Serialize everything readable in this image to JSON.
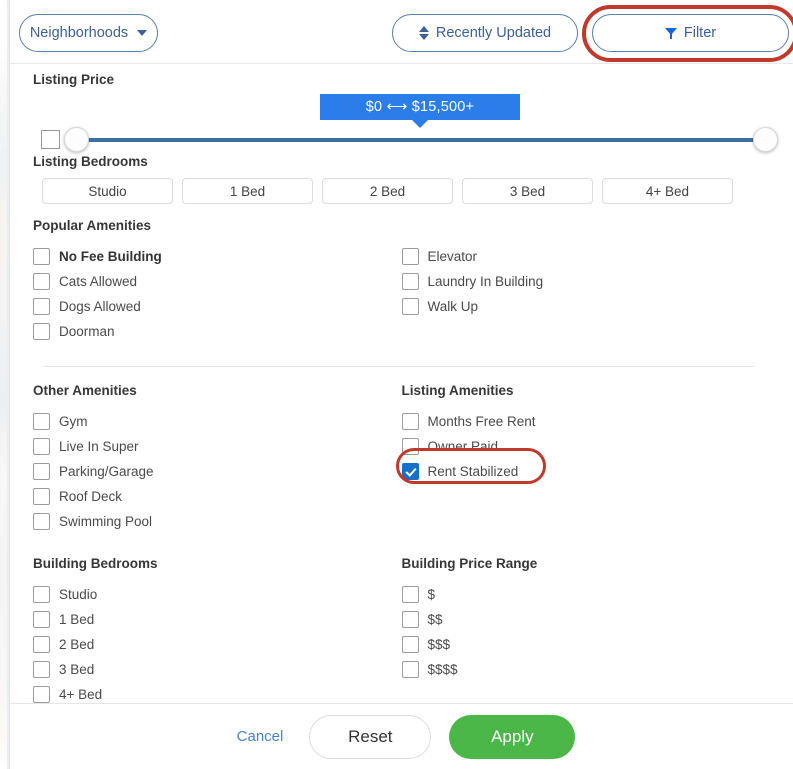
{
  "header": {
    "neighborhoods_label": "Neighborhoods",
    "sort_label": "Recently Updated",
    "filter_label": "Filter"
  },
  "price": {
    "title": "Listing Price",
    "tooltip": "$0 ⟷ $15,500+"
  },
  "listing_bedrooms": {
    "title": "Listing Bedrooms",
    "options": [
      "Studio",
      "1 Bed",
      "2 Bed",
      "3 Bed",
      "4+ Bed"
    ]
  },
  "popular_amenities": {
    "title": "Popular Amenities",
    "left": [
      {
        "label": "No Fee Building",
        "checked": false,
        "strong": true
      },
      {
        "label": "Cats Allowed",
        "checked": false,
        "strong": false
      },
      {
        "label": "Dogs Allowed",
        "checked": false,
        "strong": false
      },
      {
        "label": "Doorman",
        "checked": false,
        "strong": false
      }
    ],
    "right": [
      {
        "label": "Elevator",
        "checked": false,
        "strong": false
      },
      {
        "label": "Laundry In Building",
        "checked": false,
        "strong": false
      },
      {
        "label": "Walk Up",
        "checked": false,
        "strong": false
      }
    ]
  },
  "other_amenities": {
    "title": "Other Amenities",
    "items": [
      {
        "label": "Gym",
        "checked": false
      },
      {
        "label": "Live In Super",
        "checked": false
      },
      {
        "label": "Parking/Garage",
        "checked": false
      },
      {
        "label": "Roof Deck",
        "checked": false
      },
      {
        "label": "Swimming Pool",
        "checked": false
      }
    ]
  },
  "listing_amenities": {
    "title": "Listing Amenities",
    "items": [
      {
        "label": "Months Free Rent",
        "checked": false
      },
      {
        "label": "Owner Paid",
        "checked": false
      },
      {
        "label": "Rent Stabilized",
        "checked": true
      }
    ]
  },
  "building_bedrooms": {
    "title": "Building Bedrooms",
    "items": [
      {
        "label": "Studio",
        "checked": false
      },
      {
        "label": "1 Bed",
        "checked": false
      },
      {
        "label": "2 Bed",
        "checked": false
      },
      {
        "label": "3 Bed",
        "checked": false
      },
      {
        "label": "4+ Bed",
        "checked": false
      }
    ]
  },
  "building_price_range": {
    "title": "Building Price Range",
    "items": [
      {
        "label": "$",
        "checked": false
      },
      {
        "label": "$$",
        "checked": false
      },
      {
        "label": "$$$",
        "checked": false
      },
      {
        "label": "$$$$",
        "checked": false
      }
    ]
  },
  "footer": {
    "cancel_label": "Cancel",
    "reset_label": "Reset",
    "apply_label": "Apply"
  },
  "colors": {
    "accent_blue": "#2b7de9",
    "link_blue": "#3c6098",
    "apply_green": "#4cb749",
    "annotation_red": "#c0392b",
    "slider_track": "#3f6ea3"
  },
  "annotations": [
    {
      "target": "filter-button",
      "shape": "oval",
      "color": "#c0392b"
    },
    {
      "target": "rent-stabilized-checkbox",
      "shape": "oval",
      "color": "#c0392b"
    }
  ]
}
